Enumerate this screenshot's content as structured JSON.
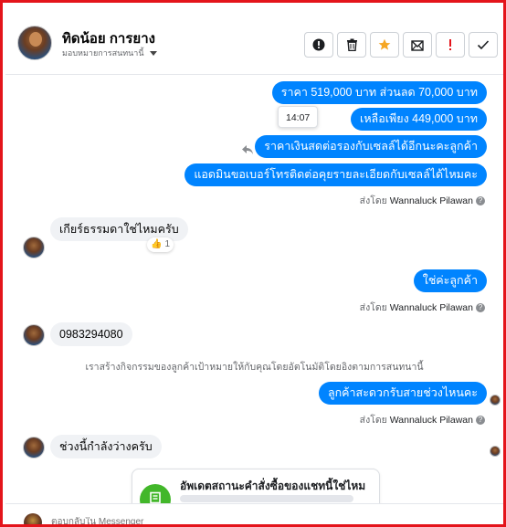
{
  "header": {
    "contact_name": "ทิดน้อย การยาง",
    "assign_label": "มอบหมายการสนทนานี้",
    "actions": [
      {
        "name": "report-button",
        "icon": "alert-circle-icon",
        "glyph": "⊘"
      },
      {
        "name": "delete-button",
        "icon": "trash-icon",
        "glyph": "🗑"
      },
      {
        "name": "star-button",
        "icon": "star-icon",
        "glyph": "★"
      },
      {
        "name": "mark-unread-button",
        "icon": "envelope-icon",
        "glyph": "✉"
      },
      {
        "name": "flag-important-button",
        "icon": "exclamation-icon",
        "glyph": "!"
      },
      {
        "name": "done-button",
        "icon": "check-icon",
        "glyph": "✓"
      }
    ]
  },
  "messages": {
    "m1": "ราคา 519,000 บาท   ส่วนลด 70,000 บาท",
    "m2": "เหลือเพียง 449,000 บาท",
    "m3": "ราคาเงินสดต่อรองกับเซลล์ได้อีกนะคะลูกค้า",
    "m4": "แอดมินขอเบอร์โทรติดต่อคุยรายละเอียดกับเซลล์ได้ไหมคะ",
    "sent_by_prefix": "ส่งโดย",
    "sent_by_name": "Wannaluck Pilawan",
    "tooltip_time": "14:07",
    "in1": "เกียร์ธรรมดาใช่ไหมครับ",
    "in1_reaction_emoji": "👍",
    "in1_reaction_count": "1",
    "m5": "ใช่ค่ะลูกค้า",
    "in2": "0983294080",
    "system_note": "เราสร้างกิจกรรมของลูกค้าเป้าหมายให้กับคุณโดยอัตโนมัติโดยอิงตามการสนทนานี้",
    "m6": "ลูกค้าสะดวกรับสายช่วงไหนคะ",
    "in3": "ช่วงนี้กำลังว่างครับ",
    "order_card_title": "อัพเดตสถานะคำสั่งซื้อของแชทนี้ใช่ไหม"
  },
  "composer": {
    "placeholder": "ตอบกลับใน Messenger"
  },
  "colors": {
    "accent": "#0084ff",
    "frame": "#e4141b",
    "incoming_bubble": "#f0f2f5",
    "star": "#f5a623",
    "flag": "#e4141b"
  }
}
